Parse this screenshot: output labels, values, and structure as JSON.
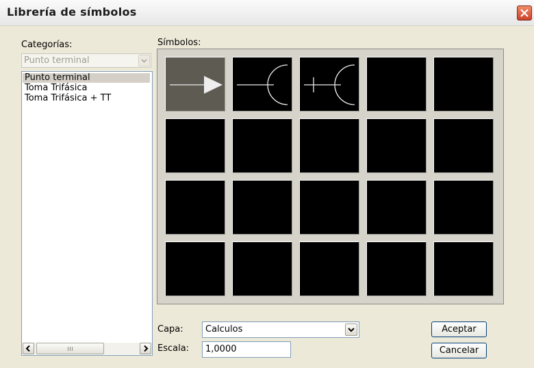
{
  "window": {
    "title": "Librería de símbolos"
  },
  "categories": {
    "label": "Categorías:",
    "selected_value": "Punto terminal",
    "items": [
      "Punto terminal",
      "Toma Trifásica",
      "Toma Trifásica + TT"
    ]
  },
  "symbols": {
    "label": "Símbolos:",
    "rows": 4,
    "cols": 5,
    "selected_index": 0,
    "icons": [
      "arrow-symbol-icon",
      "line-arc-symbol-icon",
      "plus-arc-symbol-icon"
    ]
  },
  "form": {
    "capa_label": "Capa:",
    "capa_value": "Calculos",
    "escala_label": "Escala:",
    "escala_value": "1,0000"
  },
  "buttons": {
    "accept": "Aceptar",
    "cancel": "Cancelar"
  },
  "colors": {
    "close": "#d9533a",
    "selected_cell": "#5e5b52",
    "cell": "#000000"
  }
}
